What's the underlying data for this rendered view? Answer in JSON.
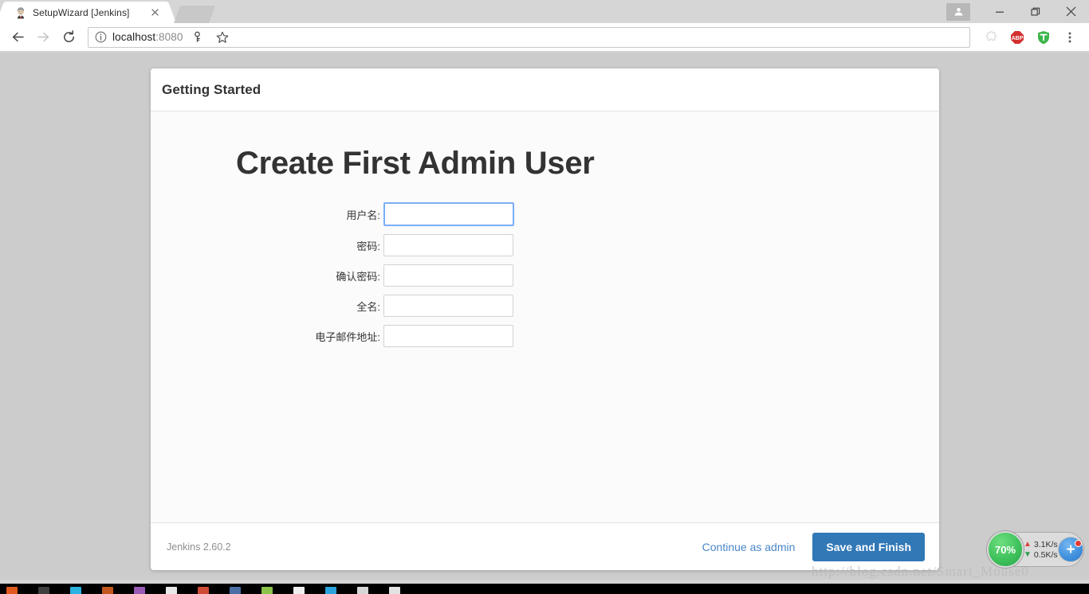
{
  "browser": {
    "tab": {
      "title": "SetupWizard [Jenkins]",
      "favicon_icon": "jenkins-butler-icon",
      "close_icon": "close-icon"
    },
    "new_tab_icon": "new-tab-button",
    "window_controls": {
      "profile_icon": "profile-person-icon",
      "minimize_icon": "minimize-icon",
      "maximize_icon": "maximize-icon",
      "close_icon": "window-close-icon"
    },
    "toolbar": {
      "back_icon": "back-arrow-icon",
      "forward_icon": "forward-arrow-icon",
      "reload_icon": "reload-icon",
      "info_icon": "page-info-icon",
      "url_host": "localhost",
      "url_port": ":8080",
      "url_full": "localhost:8080",
      "save_password_icon": "key-icon",
      "bookmark_icon": "star-icon",
      "extension_icon": "puzzle-icon",
      "adblock_icon": "adblock-plus-icon",
      "adblock_label": "ABP",
      "shield_icon": "shield-extension-icon",
      "menu_icon": "three-dot-menu-icon"
    }
  },
  "page": {
    "header_title": "Getting Started",
    "main_title": "Create First Admin User",
    "form": {
      "fields": [
        {
          "label": "用户名:",
          "name": "username-field",
          "value": "",
          "type": "text",
          "focused": true
        },
        {
          "label": "密码:",
          "name": "password-field",
          "value": "",
          "type": "password",
          "focused": false
        },
        {
          "label": "确认密码:",
          "name": "confirm-password-field",
          "value": "",
          "type": "password",
          "focused": false
        },
        {
          "label": "全名:",
          "name": "fullname-field",
          "value": "",
          "type": "text",
          "focused": false
        },
        {
          "label": "电子邮件地址:",
          "name": "email-field",
          "value": "",
          "type": "text",
          "focused": false
        }
      ]
    },
    "footer": {
      "version": "Jenkins 2.60.2",
      "continue_link": "Continue as admin",
      "save_button": "Save and Finish"
    }
  },
  "watermark": "http://blog.csdn.net/Smart_Mouse0",
  "net_widget": {
    "cpu_percent": "70%",
    "upload_speed": "3.1K/s",
    "download_speed": "0.5K/s",
    "upload_icon": "arrow-up-icon",
    "download_icon": "arrow-down-icon",
    "expand_icon": "plus-icon",
    "notification_badge_icon": "red-dot-badge"
  },
  "colors": {
    "primary_button": "#3178b6",
    "link": "#4a87c7",
    "focus_border": "#7aaef7",
    "page_background": "#cccccc",
    "net_circle": "#3fc25c"
  }
}
